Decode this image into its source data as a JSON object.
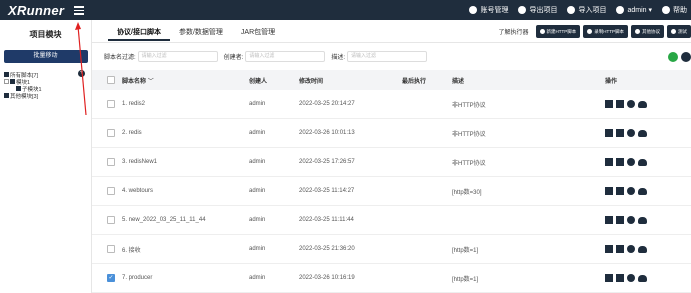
{
  "topbar": {
    "logo": "XRunner",
    "items": [
      {
        "label": "账号管理",
        "icon": "user-icon"
      },
      {
        "label": "导出项目",
        "icon": "cloud-upload-icon"
      },
      {
        "label": "导入项目",
        "icon": "cloud-download-icon"
      },
      {
        "label": "admin ▾",
        "icon": "person-icon"
      },
      {
        "label": "帮助",
        "icon": "help-icon"
      }
    ]
  },
  "sidebar": {
    "title": "项目模块",
    "batch_button": "批量移动",
    "tree": [
      {
        "label": "所有脚本[7]"
      },
      {
        "label": "模块1"
      },
      {
        "label": "子模块1"
      },
      {
        "label": "其他模块[3]"
      }
    ]
  },
  "tabs": [
    {
      "label": "协议/接口脚本",
      "active": true
    },
    {
      "label": "参数/数据管理",
      "active": false
    },
    {
      "label": "JAR包管理",
      "active": false
    }
  ],
  "toolbar": {
    "exec_link": "了解执行器",
    "buttons": [
      "新建HTTP脚本",
      "录制HTTP脚本",
      "其他协议",
      "测试"
    ]
  },
  "filters": [
    {
      "label": "脚本名过滤:",
      "placeholder": "请输入过滤"
    },
    {
      "label": "创建者:",
      "placeholder": "请输入过滤"
    },
    {
      "label": "描述:",
      "placeholder": "请输入过滤"
    }
  ],
  "table": {
    "headers": [
      "脚本名称",
      "创建人",
      "修改时间",
      "最后执行",
      "描述",
      "操作"
    ],
    "rows": [
      {
        "name": "1. redis2",
        "creator": "admin",
        "modified": "2022-03-25 20:14:27",
        "last": "",
        "desc": "非HTTP协议",
        "checked": false
      },
      {
        "name": "2. redis",
        "creator": "admin",
        "modified": "2022-03-26 10:01:13",
        "last": "",
        "desc": "非HTTP协议",
        "checked": false
      },
      {
        "name": "3. redisNew1",
        "creator": "admin",
        "modified": "2022-03-25 17:26:57",
        "last": "",
        "desc": "非HTTP协议",
        "checked": false
      },
      {
        "name": "4. webtours",
        "creator": "admin",
        "modified": "2022-03-25 11:14:27",
        "last": "",
        "desc": "[http数=30]",
        "checked": false
      },
      {
        "name": "5. new_2022_03_25_11_11_44",
        "creator": "admin",
        "modified": "2022-03-25 11:11:44",
        "last": "",
        "desc": "",
        "checked": false
      },
      {
        "name": "6. 接收",
        "creator": "admin",
        "modified": "2022-03-25 21:36:20",
        "last": "",
        "desc": "[http数=1]",
        "checked": false
      },
      {
        "name": "7. producer",
        "creator": "admin",
        "modified": "2022-03-26 10:16:19",
        "last": "",
        "desc": "[http数=1]",
        "checked": true
      }
    ]
  }
}
